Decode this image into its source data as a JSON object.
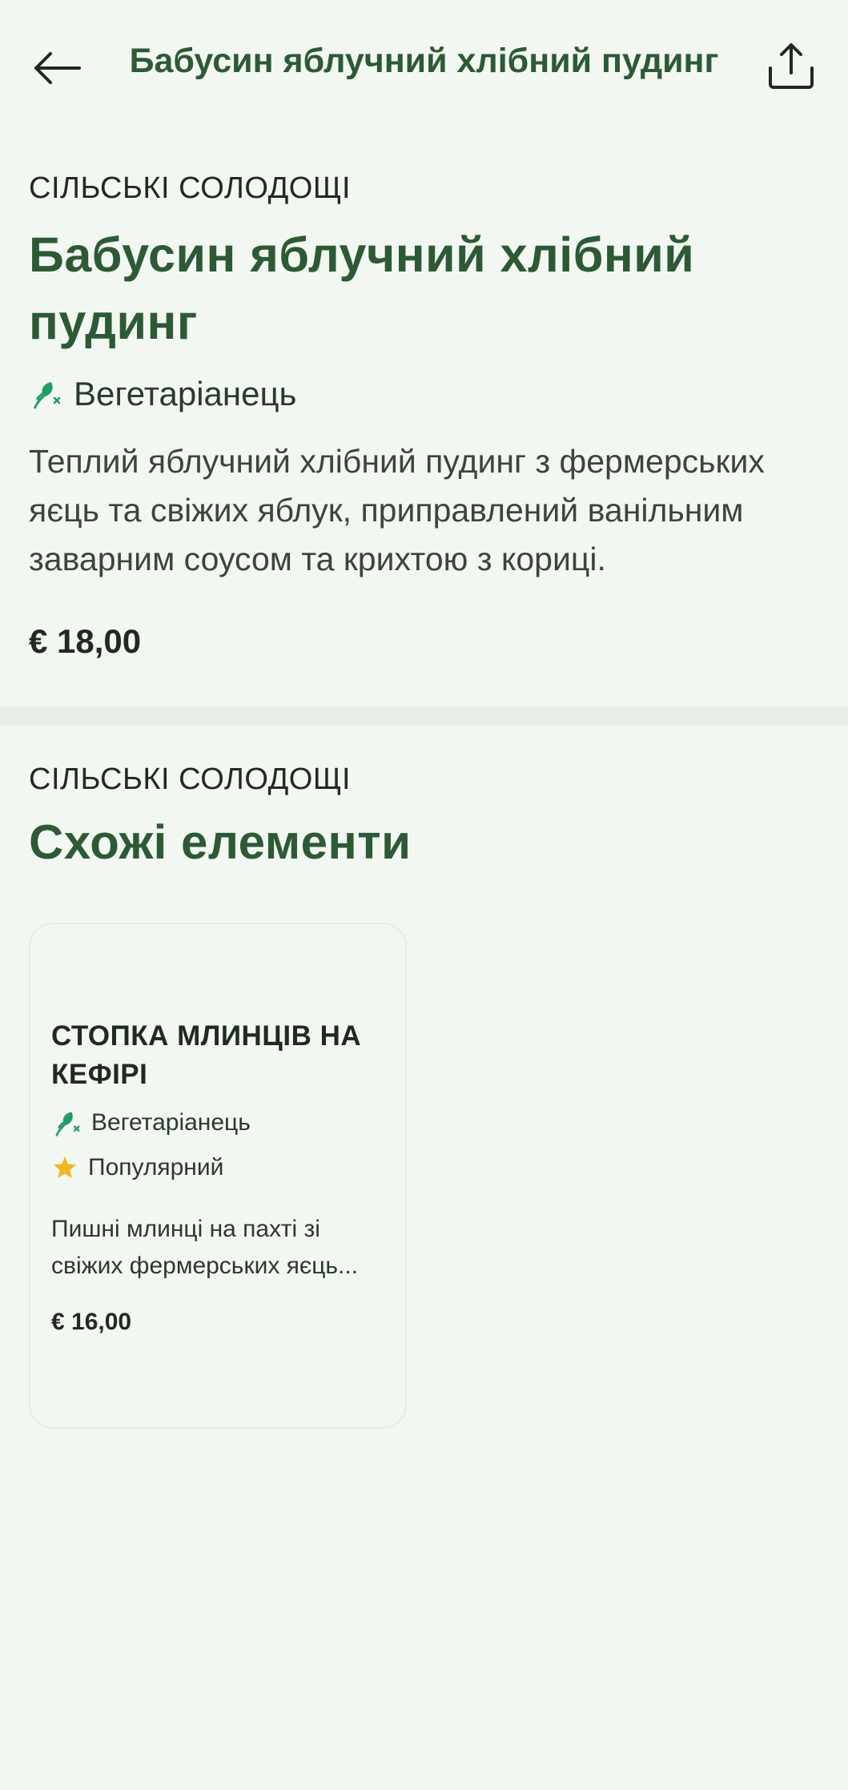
{
  "header": {
    "title": "Бабусин яблучний хлібний пудинг",
    "back_icon": "arrow-left-icon",
    "share_icon": "share-icon"
  },
  "item": {
    "category": "СІЛЬСЬКІ СОЛОДОЩІ",
    "title": "Бабусин яблучний хлібний пудинг",
    "tag": "Вегетаріанець",
    "description": "Теплий яблучний хлібний пудинг з фермерських яєць та свіжих яблук, приправлений ванільним заварним соусом та крихтою з кориці.",
    "price": "€ 18,00"
  },
  "similar": {
    "category": "СІЛЬСЬКІ СОЛОДОЩІ",
    "title": "Схожі елементи",
    "items": [
      {
        "name": "СТОПКА МЛИНЦІВ НА КЕФІРІ",
        "tags": [
          "Вегетаріанець",
          "Популярний"
        ],
        "description": "Пишні млинці на пахті зі свіжих фермерських яєць...",
        "price": "€ 16,00"
      }
    ]
  },
  "colors": {
    "background": "#f3f7f2",
    "accent": "#2c5a35",
    "vegetarian_icon": "#1f9d62",
    "star": "#f2b824"
  }
}
